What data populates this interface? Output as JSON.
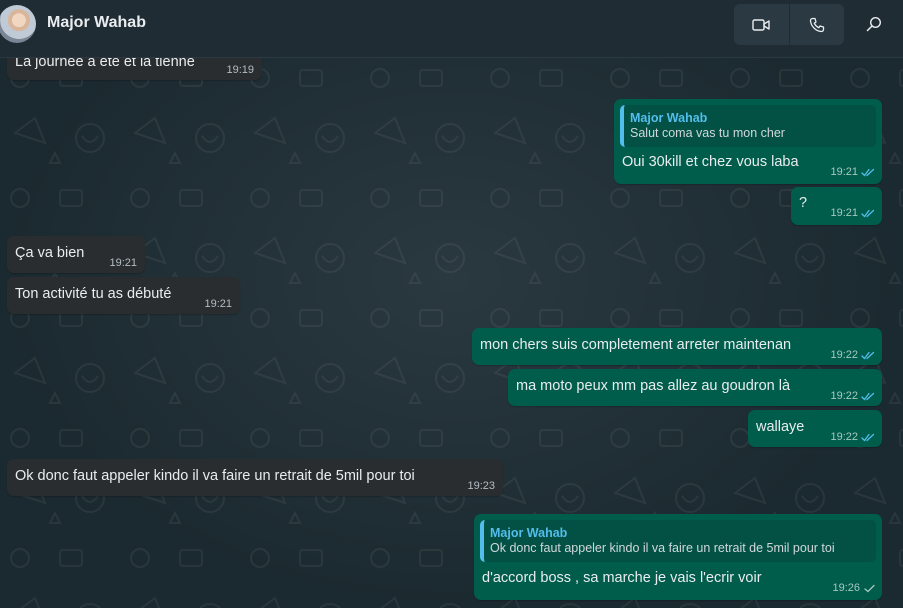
{
  "header": {
    "contact_name": "Major Wahab",
    "avatar_icon": "contact-avatar",
    "video_call_icon": "video-camera-icon",
    "voice_call_icon": "phone-icon",
    "search_icon": "search-icon"
  },
  "colors": {
    "incoming_bubble": "#2a2d30",
    "outgoing_bubble": "#005c4b",
    "quote_accent": "#53bdeb",
    "read_ticks": "#53bdeb"
  },
  "messages": [
    {
      "direction": "incoming",
      "text": "La journée a été et la tienne",
      "time": "19:19"
    },
    {
      "direction": "outgoing",
      "quote_author": "Major Wahab",
      "quote_text": "Salut coma vas tu mon cher",
      "text": "Oui 30kill et chez vous laba",
      "time": "19:21",
      "status": "read"
    },
    {
      "direction": "outgoing",
      "text": "?",
      "time": "19:21",
      "status": "read"
    },
    {
      "direction": "incoming",
      "text": "Ça va bien",
      "time": "19:21"
    },
    {
      "direction": "incoming",
      "text": "Ton activité tu as débuté",
      "time": "19:21"
    },
    {
      "direction": "outgoing",
      "text": "mon chers suis completement arreter maintenan",
      "time": "19:22",
      "status": "read"
    },
    {
      "direction": "outgoing",
      "text": "ma moto peux mm pas allez au goudron là",
      "time": "19:22",
      "status": "read"
    },
    {
      "direction": "outgoing",
      "text": "wallaye",
      "time": "19:22",
      "status": "read"
    },
    {
      "direction": "incoming",
      "text": "Ok donc faut appeler kindo il va faire un retrait de 5mil pour toi",
      "time": "19:23"
    },
    {
      "direction": "outgoing",
      "quote_author": "Major Wahab",
      "quote_text": "Ok donc faut appeler kindo il va faire un retrait de 5mil pour toi",
      "text": "d'accord boss , sa marche je vais l'ecrir voir",
      "time": "19:26",
      "status": "sent"
    }
  ]
}
